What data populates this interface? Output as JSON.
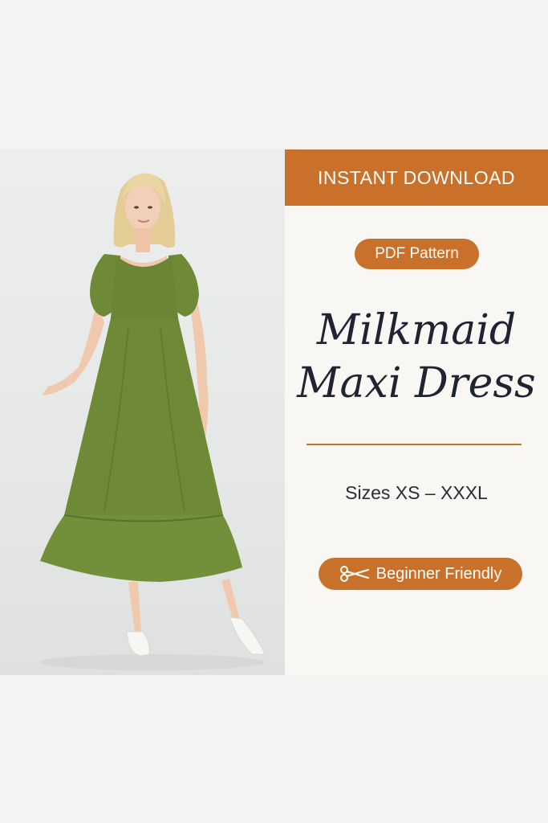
{
  "banner": {
    "text": "INSTANT DOWNLOAD"
  },
  "badge_format": {
    "text": "PDF Pattern"
  },
  "title": {
    "line1": "Milkmaid",
    "line2": "Maxi Dress"
  },
  "sizes": {
    "text": "Sizes XS – XXXL"
  },
  "badge_level": {
    "text": "Beginner Friendly",
    "icon": "scissors-icon"
  },
  "colors": {
    "accent": "#c9712a",
    "dress": "#6e8a37",
    "title": "#1f2433",
    "panel": "#f8f7f4"
  },
  "photo": {
    "subject": "model-in-green-dress"
  }
}
